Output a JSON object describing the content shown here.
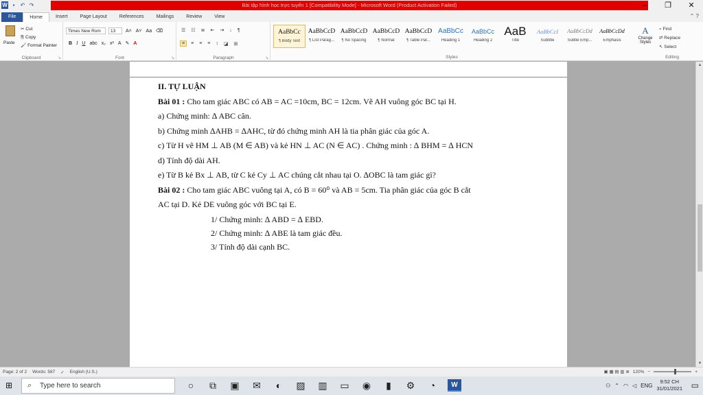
{
  "window": {
    "title": "Bài tập hình học trực tuyến 1 [Compatibility Mode] - Microsoft Word (Product Activation Failed)"
  },
  "tabs": [
    "File",
    "Home",
    "Insert",
    "Page Layout",
    "References",
    "Mailings",
    "Review",
    "View"
  ],
  "ribbon": {
    "clipboard": {
      "paste": "Paste",
      "cut": "Cut",
      "copy": "Copy",
      "format_painter": "Format Painter",
      "label": "Clipboard"
    },
    "font": {
      "name": "Times New Rom",
      "size": "13",
      "label": "Font"
    },
    "paragraph": {
      "label": "Paragraph"
    },
    "styles": {
      "label": "Styles",
      "items": [
        {
          "sample": "AaBbCc",
          "name": "¶ Body Text"
        },
        {
          "sample": "AaBbCcD",
          "name": "¶ List Parag..."
        },
        {
          "sample": "AaBbCcD",
          "name": "¶ No Spacing"
        },
        {
          "sample": "AaBbCcD",
          "name": "¶ Normal"
        },
        {
          "sample": "AaBbCcD",
          "name": "¶ Table Par..."
        },
        {
          "sample": "AaBbCc",
          "name": "Heading 1"
        },
        {
          "sample": "AaBbCc",
          "name": "Heading 2"
        },
        {
          "sample": "AaB",
          "name": "Title"
        },
        {
          "sample": "AaBbCcI",
          "name": "Subtitle"
        },
        {
          "sample": "AaBbCcDd",
          "name": "Subtle Emp..."
        },
        {
          "sample": "AaBbCcDd",
          "name": "Emphasis"
        }
      ],
      "change_styles": "Change Styles"
    },
    "editing": {
      "find": "Find",
      "replace": "Replace",
      "select": "Select",
      "label": "Editing"
    }
  },
  "document": {
    "lines": [
      {
        "bold": "II. TỰ LUẬN",
        "text": ""
      },
      {
        "bold": "Bài 01 :",
        "text": " Cho tam giác ABC có AB = AC =10cm, BC = 12cm. Vẽ AH vuông góc BC tại H."
      },
      {
        "bold": "",
        "text": "a) Chứng minh: ∆ ABC cân."
      },
      {
        "bold": "",
        "text": "b) Chứng minh ∆AHB = ∆AHC, từ đó chứng minh AH là tia phân giác của góc A."
      },
      {
        "bold": "",
        "text": "c) Từ H vẽ HM ⊥ AB (M ∈ AB) và kẻ HN ⊥ AC (N ∈ AC) . Chứng minh : ∆ BHM = ∆ HCN"
      },
      {
        "bold": "",
        "text": "d) Tính độ dài AH."
      },
      {
        "bold": "",
        "text": "e) Từ B kẻ Bx ⊥ AB, từ C kẻ Cy ⊥ AC chúng cắt nhau tại O. ∆OBC là tam giác gì?"
      },
      {
        "bold": "Bài 02 :",
        "text": " Cho tam giác ABC vuông tại A, có  B = 60⁰ và AB = 5cm. Tia phân giác của góc B cắt"
      },
      {
        "bold": "",
        "text": "AC tại D. Kẻ DE vuông góc với BC tại E."
      }
    ],
    "sublines": [
      "1/ Chứng minh: ∆ ABD = ∆ EBD.",
      "2/ Chứng minh: ∆ ABE là tam giác đều.",
      "3/ Tính độ dài cạnh BC."
    ]
  },
  "status": {
    "page": "Page: 2 of 2",
    "words": "Words: 587",
    "language": "English (U.S.)",
    "zoom": "120%"
  },
  "taskbar": {
    "search_placeholder": "Type here to search",
    "language": "ENG",
    "time": "9:52 CH",
    "date": "31/01/2021"
  }
}
